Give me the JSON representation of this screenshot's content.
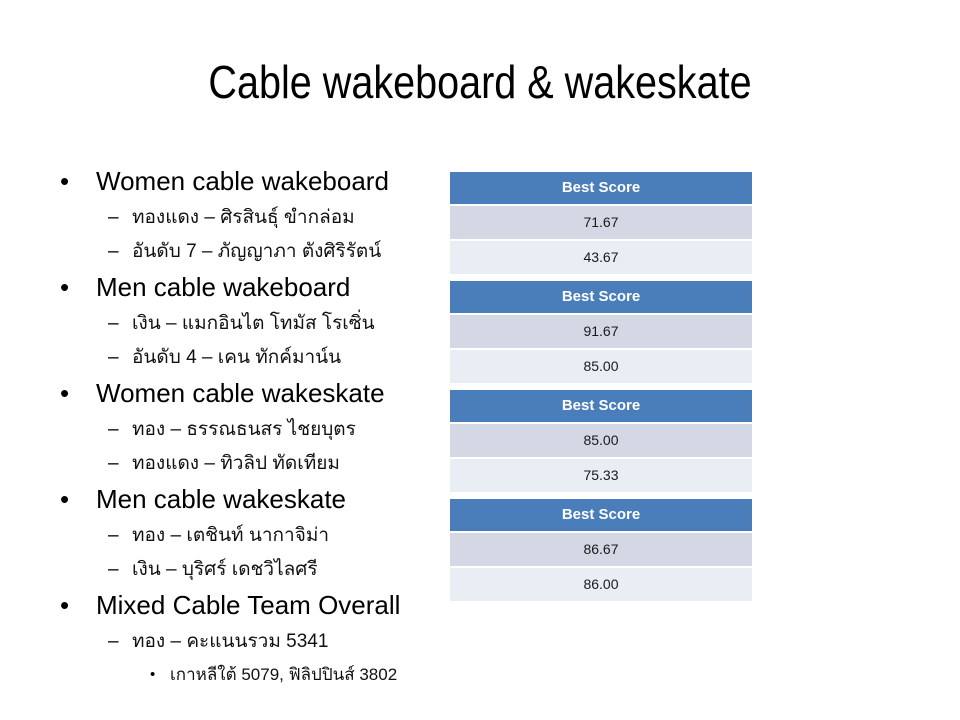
{
  "slide": {
    "title": "Cable wakeboard & wakeskate",
    "background_color": "#ffffff"
  },
  "table_style": {
    "header_bg": "#4a7ebb",
    "header_text": "#ffffff",
    "row_odd_bg": "#d3d8e4",
    "row_even_bg": "#e9edf4",
    "row_text": "#1a1a1a"
  },
  "markers": {
    "level1": "•",
    "level2": "–",
    "level3": "•"
  },
  "sections": [
    {
      "heading": "Women cable wakeboard",
      "details": [
        "ทองแดง – ศิรสินธุ์ ขำกล่อม",
        "อันดับ 7 – ภัญญาภา ตังศิริรัตน์"
      ],
      "table": {
        "header": "Best Score",
        "scores": [
          "71.67",
          "43.67"
        ]
      }
    },
    {
      "heading": "Men cable wakeboard",
      "details": [
        "เงิน – แมกอินไต โทมัส โรเซิ่น",
        "อันดับ 4 – เคน ทักค์มาน์น"
      ],
      "table": {
        "header": "Best Score",
        "scores": [
          "91.67",
          "85.00"
        ]
      }
    },
    {
      "heading": "Women cable wakeskate",
      "details": [
        "ทอง – ธรรณธนสร ไชยบุตร",
        "ทองแดง – ทิวลิป ทัดเทียม"
      ],
      "table": {
        "header": "Best Score",
        "scores": [
          "85.00",
          "75.33"
        ]
      }
    },
    {
      "heading": "Men cable wakeskate",
      "details": [
        "ทอง – เตชินท์ นากาจิม่า",
        "เงิน – บุริศร์ เดชวิไลศรี"
      ],
      "table": {
        "header": "Best Score",
        "scores": [
          "86.67",
          "86.00"
        ]
      }
    },
    {
      "heading": "Mixed Cable Team Overall",
      "details": [
        "ทอง – คะแนนรวม 5341"
      ],
      "subdetails": [
        "เกาหลีใต้ 5079, ฟิลิปปินส์ 3802"
      ],
      "table": null
    }
  ]
}
